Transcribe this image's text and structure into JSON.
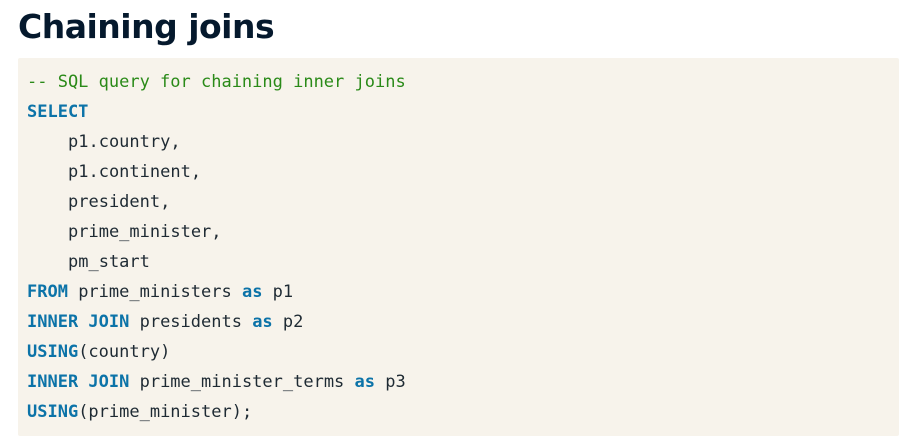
{
  "slide": {
    "title": "Chaining joins"
  },
  "code": {
    "comment": "-- SQL query for chaining inner joins",
    "select_kw": "SELECT",
    "col1": "p1.country,",
    "col2": "p1.continent,",
    "col3": "president,",
    "col4": "prime_minister,",
    "col5": "pm_start",
    "from_kw": "FROM",
    "from_table": " prime_ministers ",
    "as_kw": "as",
    "alias1": " p1",
    "inner_join_kw": "INNER JOIN",
    "join1_table": " presidents ",
    "alias2": " p2",
    "using_kw": "USING",
    "using1_arg": "(country)",
    "join2_table": " prime_minister_terms ",
    "alias3": " p3",
    "using2_arg": "(prime_minister);"
  },
  "colors": {
    "title": "#05192d",
    "code_background": "#f7f3eb",
    "comment": "#2a8a18",
    "keyword": "#0c73a8",
    "text": "#1e2a33"
  }
}
